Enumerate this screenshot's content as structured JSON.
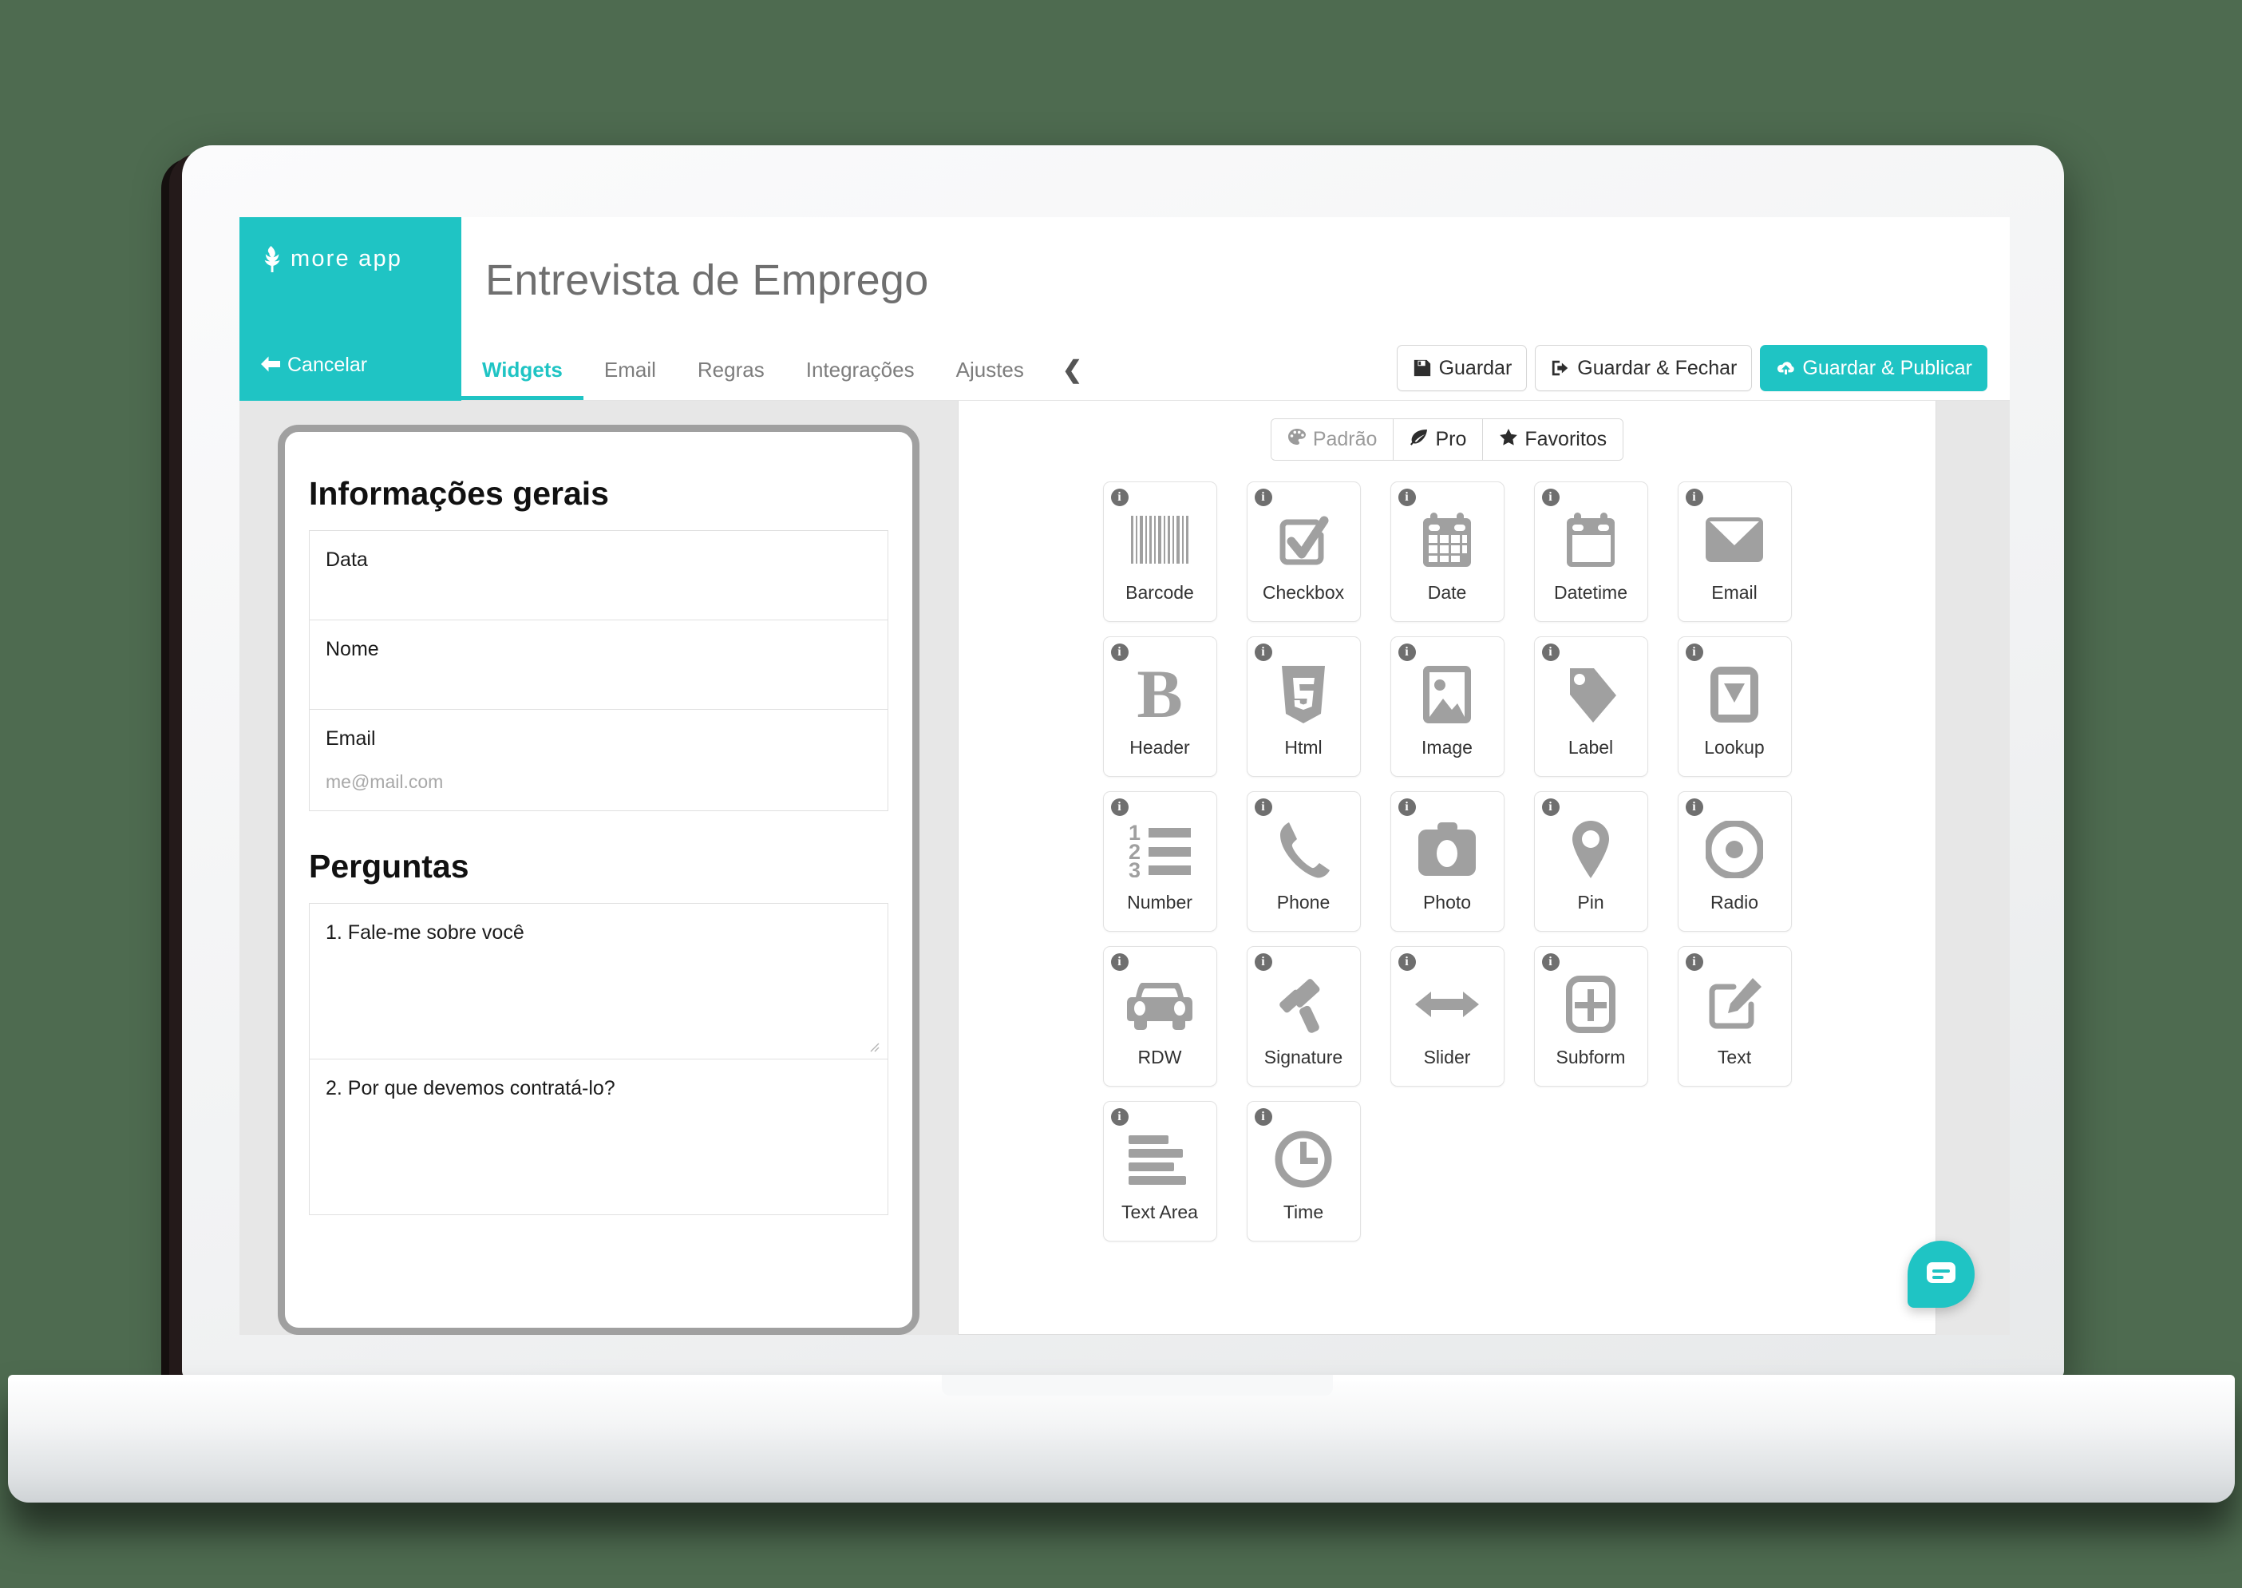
{
  "brand": {
    "name": "more app",
    "logo_icon": "moreapp-leaf-logo",
    "cancel_label": "Cancelar",
    "cancel_icon": "arrow-left-icon",
    "color": "#1fc4c4"
  },
  "header": {
    "title": "Entrevista de Emprego"
  },
  "tabs": [
    {
      "label": "Widgets",
      "active": true
    },
    {
      "label": "Email",
      "active": false
    },
    {
      "label": "Regras",
      "active": false
    },
    {
      "label": "Integrações",
      "active": false
    },
    {
      "label": "Ajustes",
      "active": false
    }
  ],
  "tab_collapse_icon": "chevron-left-icon",
  "actions": [
    {
      "label": "Guardar",
      "icon": "floppy-disk-icon",
      "primary": false
    },
    {
      "label": "Guardar & Fechar",
      "icon": "sign-out-icon",
      "primary": false
    },
    {
      "label": "Guardar & Publicar",
      "icon": "cloud-upload-icon",
      "primary": true
    }
  ],
  "preview": {
    "sections": [
      {
        "title": "Informações gerais",
        "fields": [
          {
            "label": "Data",
            "placeholder": "",
            "size": "short"
          },
          {
            "label": "Nome",
            "placeholder": "",
            "size": "short"
          },
          {
            "label": "Email",
            "placeholder": "me@mail.com",
            "size": "short"
          }
        ]
      },
      {
        "title": "Perguntas",
        "fields": [
          {
            "label": "1. Fale-me sobre você",
            "placeholder": "",
            "size": "tall",
            "resizable": true
          },
          {
            "label": "2. Por que devemos contratá-lo?",
            "placeholder": "",
            "size": "tall",
            "resizable": false
          }
        ]
      }
    ]
  },
  "widget_filters": [
    {
      "label": "Padrão",
      "icon": "palette-icon",
      "state": "muted"
    },
    {
      "label": "Pro",
      "icon": "leaf-icon",
      "state": "dark"
    },
    {
      "label": "Favoritos",
      "icon": "star-icon",
      "state": "dark"
    }
  ],
  "widgets": [
    {
      "label": "Barcode",
      "icon": "barcode-icon"
    },
    {
      "label": "Checkbox",
      "icon": "checkbox-icon"
    },
    {
      "label": "Date",
      "icon": "calendar-icon"
    },
    {
      "label": "Datetime",
      "icon": "calendar-blank-icon"
    },
    {
      "label": "Email",
      "icon": "envelope-icon"
    },
    {
      "label": "Header",
      "icon": "letter-b-icon"
    },
    {
      "label": "Html",
      "icon": "html5-icon"
    },
    {
      "label": "Image",
      "icon": "picture-icon"
    },
    {
      "label": "Label",
      "icon": "tag-icon"
    },
    {
      "label": "Lookup",
      "icon": "dropdown-icon"
    },
    {
      "label": "Number",
      "icon": "numbered-list-icon"
    },
    {
      "label": "Phone",
      "icon": "phone-icon"
    },
    {
      "label": "Photo",
      "icon": "camera-icon"
    },
    {
      "label": "Pin",
      "icon": "map-pin-icon"
    },
    {
      "label": "Radio",
      "icon": "radio-button-icon"
    },
    {
      "label": "RDW",
      "icon": "car-icon"
    },
    {
      "label": "Signature",
      "icon": "gavel-icon"
    },
    {
      "label": "Slider",
      "icon": "arrows-horizontal-icon"
    },
    {
      "label": "Subform",
      "icon": "plus-square-icon"
    },
    {
      "label": "Text",
      "icon": "pencil-square-icon"
    },
    {
      "label": "Text Area",
      "icon": "text-lines-icon"
    },
    {
      "label": "Time",
      "icon": "clock-icon"
    }
  ],
  "widget_info_badge": "i",
  "chat": {
    "icon": "chat-bubble-icon",
    "color": "#1fc4c4"
  }
}
